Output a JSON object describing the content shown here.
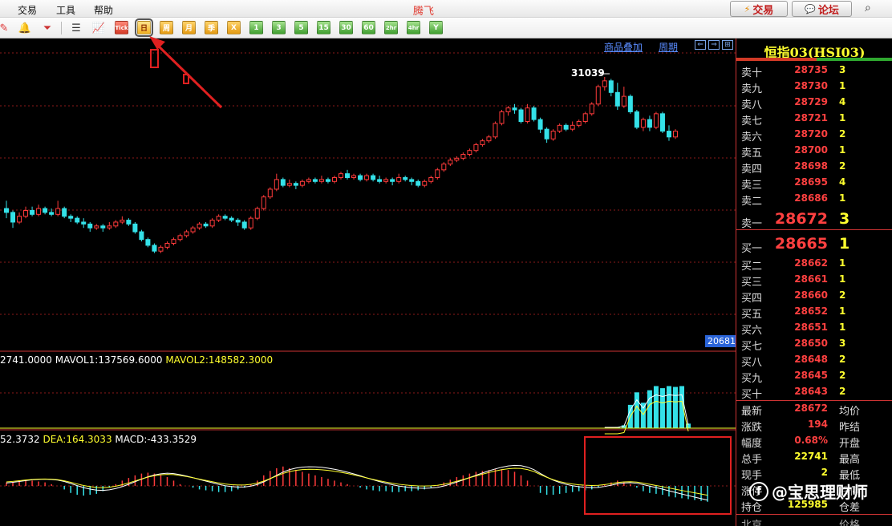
{
  "menu": {
    "items": [
      "交易",
      "工具",
      "帮助"
    ],
    "app_title": "腾飞",
    "trade_button": "交易",
    "forum_button": "论坛"
  },
  "toolbar": {
    "icons": [
      "pen-icon",
      "bell-icon",
      "filter-icon",
      "list-icon",
      "chart-line-icon"
    ],
    "tick_label": "Tick",
    "period_buttons": [
      "日",
      "周",
      "月",
      "季",
      "X",
      "1",
      "3",
      "5",
      "15",
      "30",
      "60",
      "2hr",
      "4hr",
      "Y"
    ],
    "active_period": "日"
  },
  "chart": {
    "link_overlay": "商品叠加",
    "link_period": "周期",
    "high_label": "31039",
    "price_tag": "20681",
    "vol_text_a": "2741.0000",
    "vol_text_b": "MAVOL1:137569.6000",
    "vol_text_c": "MAVOL2:148582.3000",
    "macd_text_a": "52.3732",
    "macd_text_b": "DEA:164.3033",
    "macd_text_c": "MACD:-433.3529",
    "colors": {
      "up": "#ff3b3b",
      "down": "#34e1e8",
      "ma1": "#ffffff",
      "ma2": "#ffff2e",
      "grid": "#8b1a1a",
      "highlight_box": "#e02020"
    }
  },
  "chart_data": {
    "type": "candlestick",
    "title": "",
    "high_marker": 31039,
    "candles": [
      {
        "o": 0.52,
        "c": 0.5,
        "h": 0.56,
        "l": 0.47
      },
      {
        "o": 0.5,
        "c": 0.45,
        "h": 0.51,
        "l": 0.42
      },
      {
        "o": 0.45,
        "c": 0.48,
        "h": 0.5,
        "l": 0.44
      },
      {
        "o": 0.48,
        "c": 0.51,
        "h": 0.53,
        "l": 0.47
      },
      {
        "o": 0.51,
        "c": 0.49,
        "h": 0.53,
        "l": 0.48
      },
      {
        "o": 0.49,
        "c": 0.52,
        "h": 0.54,
        "l": 0.48
      },
      {
        "o": 0.52,
        "c": 0.5,
        "h": 0.53,
        "l": 0.49
      },
      {
        "o": 0.5,
        "c": 0.49,
        "h": 0.52,
        "l": 0.48
      },
      {
        "o": 0.49,
        "c": 0.52,
        "h": 0.56,
        "l": 0.48
      },
      {
        "o": 0.52,
        "c": 0.48,
        "h": 0.53,
        "l": 0.47
      },
      {
        "o": 0.48,
        "c": 0.47,
        "h": 0.49,
        "l": 0.45
      },
      {
        "o": 0.47,
        "c": 0.45,
        "h": 0.48,
        "l": 0.44
      },
      {
        "o": 0.45,
        "c": 0.44,
        "h": 0.47,
        "l": 0.42
      },
      {
        "o": 0.44,
        "c": 0.42,
        "h": 0.45,
        "l": 0.4
      },
      {
        "o": 0.42,
        "c": 0.43,
        "h": 0.44,
        "l": 0.41
      },
      {
        "o": 0.43,
        "c": 0.42,
        "h": 0.44,
        "l": 0.4
      },
      {
        "o": 0.42,
        "c": 0.43,
        "h": 0.45,
        "l": 0.41
      },
      {
        "o": 0.43,
        "c": 0.45,
        "h": 0.46,
        "l": 0.42
      },
      {
        "o": 0.45,
        "c": 0.46,
        "h": 0.48,
        "l": 0.44
      },
      {
        "o": 0.46,
        "c": 0.44,
        "h": 0.47,
        "l": 0.43
      },
      {
        "o": 0.44,
        "c": 0.4,
        "h": 0.45,
        "l": 0.39
      },
      {
        "o": 0.4,
        "c": 0.36,
        "h": 0.41,
        "l": 0.35
      },
      {
        "o": 0.36,
        "c": 0.33,
        "h": 0.37,
        "l": 0.32
      },
      {
        "o": 0.33,
        "c": 0.3,
        "h": 0.34,
        "l": 0.29
      },
      {
        "o": 0.3,
        "c": 0.32,
        "h": 0.33,
        "l": 0.29
      },
      {
        "o": 0.32,
        "c": 0.34,
        "h": 0.35,
        "l": 0.31
      },
      {
        "o": 0.34,
        "c": 0.36,
        "h": 0.37,
        "l": 0.33
      },
      {
        "o": 0.36,
        "c": 0.38,
        "h": 0.39,
        "l": 0.35
      },
      {
        "o": 0.38,
        "c": 0.4,
        "h": 0.41,
        "l": 0.37
      },
      {
        "o": 0.4,
        "c": 0.42,
        "h": 0.43,
        "l": 0.39
      },
      {
        "o": 0.42,
        "c": 0.44,
        "h": 0.45,
        "l": 0.41
      },
      {
        "o": 0.44,
        "c": 0.43,
        "h": 0.45,
        "l": 0.42
      },
      {
        "o": 0.43,
        "c": 0.46,
        "h": 0.47,
        "l": 0.42
      },
      {
        "o": 0.46,
        "c": 0.48,
        "h": 0.49,
        "l": 0.45
      },
      {
        "o": 0.48,
        "c": 0.47,
        "h": 0.49,
        "l": 0.46
      },
      {
        "o": 0.47,
        "c": 0.46,
        "h": 0.48,
        "l": 0.45
      },
      {
        "o": 0.46,
        "c": 0.45,
        "h": 0.47,
        "l": 0.43
      },
      {
        "o": 0.45,
        "c": 0.42,
        "h": 0.46,
        "l": 0.41
      },
      {
        "o": 0.42,
        "c": 0.47,
        "h": 0.48,
        "l": 0.41
      },
      {
        "o": 0.47,
        "c": 0.52,
        "h": 0.53,
        "l": 0.46
      },
      {
        "o": 0.52,
        "c": 0.58,
        "h": 0.59,
        "l": 0.51
      },
      {
        "o": 0.58,
        "c": 0.62,
        "h": 0.63,
        "l": 0.57
      },
      {
        "o": 0.62,
        "c": 0.67,
        "h": 0.7,
        "l": 0.61
      },
      {
        "o": 0.67,
        "c": 0.64,
        "h": 0.68,
        "l": 0.63
      },
      {
        "o": 0.64,
        "c": 0.65,
        "h": 0.67,
        "l": 0.63
      },
      {
        "o": 0.65,
        "c": 0.64,
        "h": 0.66,
        "l": 0.62
      },
      {
        "o": 0.64,
        "c": 0.66,
        "h": 0.67,
        "l": 0.63
      },
      {
        "o": 0.66,
        "c": 0.67,
        "h": 0.68,
        "l": 0.65
      },
      {
        "o": 0.67,
        "c": 0.66,
        "h": 0.68,
        "l": 0.65
      },
      {
        "o": 0.66,
        "c": 0.67,
        "h": 0.69,
        "l": 0.65
      },
      {
        "o": 0.67,
        "c": 0.66,
        "h": 0.68,
        "l": 0.65
      },
      {
        "o": 0.66,
        "c": 0.68,
        "h": 0.69,
        "l": 0.65
      },
      {
        "o": 0.68,
        "c": 0.7,
        "h": 0.71,
        "l": 0.67
      },
      {
        "o": 0.7,
        "c": 0.68,
        "h": 0.72,
        "l": 0.67
      },
      {
        "o": 0.68,
        "c": 0.69,
        "h": 0.7,
        "l": 0.67
      },
      {
        "o": 0.69,
        "c": 0.67,
        "h": 0.7,
        "l": 0.66
      },
      {
        "o": 0.67,
        "c": 0.69,
        "h": 0.7,
        "l": 0.66
      },
      {
        "o": 0.69,
        "c": 0.67,
        "h": 0.7,
        "l": 0.66
      },
      {
        "o": 0.67,
        "c": 0.66,
        "h": 0.69,
        "l": 0.65
      },
      {
        "o": 0.66,
        "c": 0.67,
        "h": 0.68,
        "l": 0.65
      },
      {
        "o": 0.67,
        "c": 0.66,
        "h": 0.68,
        "l": 0.64
      },
      {
        "o": 0.66,
        "c": 0.68,
        "h": 0.7,
        "l": 0.65
      },
      {
        "o": 0.68,
        "c": 0.67,
        "h": 0.69,
        "l": 0.66
      },
      {
        "o": 0.67,
        "c": 0.66,
        "h": 0.68,
        "l": 0.64
      },
      {
        "o": 0.66,
        "c": 0.64,
        "h": 0.67,
        "l": 0.63
      },
      {
        "o": 0.64,
        "c": 0.66,
        "h": 0.67,
        "l": 0.63
      },
      {
        "o": 0.66,
        "c": 0.68,
        "h": 0.69,
        "l": 0.65
      },
      {
        "o": 0.68,
        "c": 0.72,
        "h": 0.73,
        "l": 0.67
      },
      {
        "o": 0.72,
        "c": 0.75,
        "h": 0.76,
        "l": 0.71
      },
      {
        "o": 0.75,
        "c": 0.77,
        "h": 0.78,
        "l": 0.74
      },
      {
        "o": 0.77,
        "c": 0.78,
        "h": 0.79,
        "l": 0.76
      },
      {
        "o": 0.78,
        "c": 0.8,
        "h": 0.81,
        "l": 0.77
      },
      {
        "o": 0.8,
        "c": 0.82,
        "h": 0.83,
        "l": 0.79
      },
      {
        "o": 0.82,
        "c": 0.85,
        "h": 0.86,
        "l": 0.81
      },
      {
        "o": 0.85,
        "c": 0.87,
        "h": 0.88,
        "l": 0.84
      },
      {
        "o": 0.87,
        "c": 0.89,
        "h": 0.9,
        "l": 0.86
      },
      {
        "o": 0.89,
        "c": 0.96,
        "h": 0.97,
        "l": 0.88
      },
      {
        "o": 0.96,
        "c": 1.02,
        "h": 1.03,
        "l": 0.95
      },
      {
        "o": 1.02,
        "c": 1.04,
        "h": 1.05,
        "l": 1.0
      },
      {
        "o": 1.04,
        "c": 1.03,
        "h": 1.06,
        "l": 1.01
      },
      {
        "o": 1.03,
        "c": 0.97,
        "h": 1.04,
        "l": 0.96
      },
      {
        "o": 0.97,
        "c": 1.04,
        "h": 1.06,
        "l": 0.96
      },
      {
        "o": 1.04,
        "c": 0.98,
        "h": 1.05,
        "l": 0.97
      },
      {
        "o": 0.98,
        "c": 0.93,
        "h": 0.99,
        "l": 0.91
      },
      {
        "o": 0.93,
        "c": 0.88,
        "h": 0.94,
        "l": 0.86
      },
      {
        "o": 0.88,
        "c": 0.92,
        "h": 0.93,
        "l": 0.87
      },
      {
        "o": 0.92,
        "c": 0.95,
        "h": 0.96,
        "l": 0.91
      },
      {
        "o": 0.95,
        "c": 0.93,
        "h": 0.96,
        "l": 0.92
      },
      {
        "o": 0.93,
        "c": 0.95,
        "h": 0.97,
        "l": 0.92
      },
      {
        "o": 0.95,
        "c": 0.97,
        "h": 0.98,
        "l": 0.94
      },
      {
        "o": 0.97,
        "c": 1.01,
        "h": 1.02,
        "l": 0.96
      },
      {
        "o": 1.01,
        "c": 1.06,
        "h": 1.07,
        "l": 1.0
      },
      {
        "o": 1.06,
        "c": 1.15,
        "h": 1.16,
        "l": 1.05
      },
      {
        "o": 1.15,
        "c": 1.18,
        "h": 1.2,
        "l": 1.13
      },
      {
        "o": 1.18,
        "c": 1.12,
        "h": 1.19,
        "l": 1.1
      },
      {
        "o": 1.12,
        "c": 1.05,
        "h": 1.17,
        "l": 1.03
      },
      {
        "o": 1.05,
        "c": 1.1,
        "h": 1.15,
        "l": 1.04
      },
      {
        "o": 1.1,
        "c": 1.02,
        "h": 1.11,
        "l": 1.01
      },
      {
        "o": 1.02,
        "c": 0.94,
        "h": 1.03,
        "l": 0.93
      },
      {
        "o": 0.94,
        "c": 0.98,
        "h": 0.99,
        "l": 0.92
      },
      {
        "o": 0.98,
        "c": 0.94,
        "h": 1.0,
        "l": 0.92
      },
      {
        "o": 0.94,
        "c": 1.01,
        "h": 1.02,
        "l": 0.93
      },
      {
        "o": 1.01,
        "c": 0.92,
        "h": 1.02,
        "l": 0.91
      },
      {
        "o": 0.92,
        "c": 0.89,
        "h": 0.95,
        "l": 0.87
      },
      {
        "o": 0.89,
        "c": 0.92,
        "h": 0.93,
        "l": 0.88
      }
    ],
    "volume": [
      0,
      0,
      0,
      0,
      0,
      0,
      0,
      0,
      0,
      0,
      0,
      0,
      0,
      0,
      0,
      0,
      0,
      0,
      0,
      0,
      0,
      0,
      0,
      0,
      0,
      0,
      0,
      0,
      0,
      0,
      0,
      0,
      0,
      0,
      0,
      0,
      0,
      0,
      0,
      0,
      0,
      0,
      0,
      0,
      0,
      0,
      0,
      0,
      0,
      0,
      0,
      0,
      0,
      0,
      0,
      0,
      0,
      0,
      0,
      0,
      0,
      0,
      0,
      0,
      0,
      0,
      0,
      0,
      0,
      0,
      0,
      0,
      0,
      0,
      0,
      0,
      0,
      0,
      0,
      0,
      0,
      0,
      0,
      0,
      0,
      0,
      0,
      0,
      0,
      0,
      0,
      0,
      0,
      0,
      0,
      0.02,
      0.06,
      0.55,
      0.85,
      0.6,
      0.9,
      1.0,
      0.95,
      1.0,
      0.98,
      1.0,
      0.1
    ],
    "macd": [
      0.2,
      0.2,
      0.25,
      0.3,
      0.3,
      0.25,
      0.2,
      0.1,
      0.0,
      -0.2,
      -0.4,
      -0.5,
      -0.55,
      -0.5,
      -0.45,
      -0.3,
      -0.1,
      0.1,
      0.3,
      0.45,
      0.6,
      0.7,
      0.75,
      0.7,
      0.6,
      0.5,
      0.3,
      0.1,
      0.0,
      -0.1,
      -0.2,
      -0.25,
      -0.3,
      -0.35,
      -0.35,
      -0.3,
      -0.2,
      -0.1,
      0.1,
      0.3,
      0.6,
      0.85,
      1.0,
      1.1,
      1.0,
      0.9,
      0.8,
      0.7,
      0.6,
      0.5,
      0.4,
      0.3,
      0.2,
      0.1,
      0.0,
      -0.1,
      -0.2,
      -0.25,
      -0.3,
      -0.3,
      -0.35,
      -0.35,
      -0.3,
      -0.3,
      -0.25,
      -0.2,
      -0.1,
      0.0,
      0.2,
      0.35,
      0.5,
      0.6,
      0.7,
      0.8,
      0.85,
      0.9,
      0.95,
      0.95,
      0.9,
      0.8,
      0.6,
      0.3,
      0.0,
      -0.4,
      -0.5,
      -0.5,
      -0.45,
      -0.4,
      -0.35,
      -0.3,
      -0.25,
      -0.2,
      -0.1,
      0.1,
      0.2,
      0.3,
      0.2,
      0.1,
      -0.1,
      -0.3,
      -0.4,
      -0.45,
      -0.5,
      -0.6,
      -0.65,
      -0.7,
      -0.75,
      -0.8,
      -0.85,
      -0.9
    ]
  },
  "quote": {
    "title": "恒指03(HSI03)",
    "asks": [
      {
        "label": "卖十",
        "price": "28735",
        "vol": "3"
      },
      {
        "label": "卖九",
        "price": "28730",
        "vol": "1"
      },
      {
        "label": "卖八",
        "price": "28729",
        "vol": "4"
      },
      {
        "label": "卖七",
        "price": "28721",
        "vol": "1"
      },
      {
        "label": "卖六",
        "price": "28720",
        "vol": "2"
      },
      {
        "label": "卖五",
        "price": "28700",
        "vol": "1"
      },
      {
        "label": "卖四",
        "price": "28698",
        "vol": "2"
      },
      {
        "label": "卖三",
        "price": "28695",
        "vol": "4"
      },
      {
        "label": "卖二",
        "price": "28686",
        "vol": "1"
      }
    ],
    "ask1": {
      "label": "卖一",
      "price": "28672",
      "vol": "3"
    },
    "bid1": {
      "label": "买一",
      "price": "28665",
      "vol": "1"
    },
    "bids": [
      {
        "label": "买二",
        "price": "28662",
        "vol": "1"
      },
      {
        "label": "买三",
        "price": "28661",
        "vol": "1"
      },
      {
        "label": "买四",
        "price": "28660",
        "vol": "2"
      },
      {
        "label": "买五",
        "price": "28652",
        "vol": "1"
      },
      {
        "label": "买六",
        "price": "28651",
        "vol": "1"
      },
      {
        "label": "买七",
        "price": "28650",
        "vol": "3"
      },
      {
        "label": "买八",
        "price": "28648",
        "vol": "2"
      },
      {
        "label": "买九",
        "price": "28645",
        "vol": "2"
      },
      {
        "label": "买十",
        "price": "28643",
        "vol": "2"
      }
    ],
    "stats": [
      {
        "label": "最新",
        "value": "28672",
        "color": "#ff4040",
        "label2": "均价"
      },
      {
        "label": "涨跌",
        "value": "194",
        "color": "#ff4040",
        "label2": "昨结"
      },
      {
        "label": "幅度",
        "value": "0.68%",
        "color": "#ff4040",
        "label2": "开盘"
      },
      {
        "label": "总手",
        "value": "22741",
        "color": "#ffff2e",
        "label2": "最高"
      },
      {
        "label": "现手",
        "value": "2",
        "color": "#ffff2e",
        "label2": "最低"
      },
      {
        "label": "涨停",
        "value": "",
        "color": "#ff4040",
        "label2": "跌停"
      },
      {
        "label": "持仓",
        "value": "125985",
        "color": "#ffff2e",
        "label2": "仓差"
      }
    ],
    "footer_left": "北京",
    "footer_right": "价格"
  },
  "watermark": {
    "text": "@宝思理财师",
    "icon": "circle-logo-icon"
  }
}
